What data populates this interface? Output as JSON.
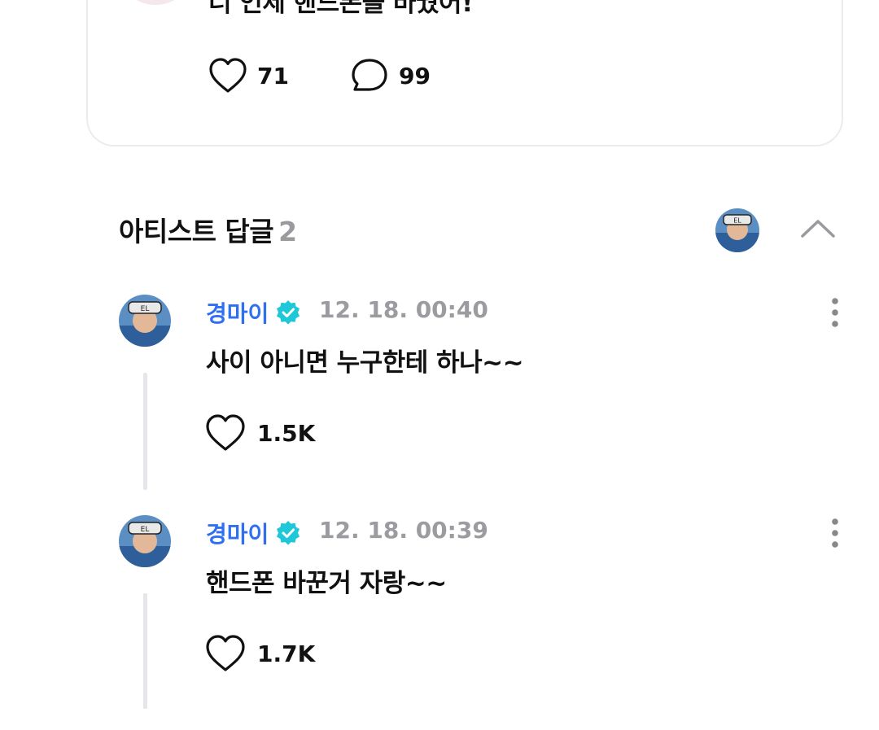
{
  "post": {
    "text": "너 언제 핸드폰을 바꿨어!",
    "likes": "71",
    "comments": "99",
    "avatar_icon": "food-bowl-avatar",
    "avatar_bg": "#f4e8ea"
  },
  "section": {
    "title": "아티스트 답글",
    "count": "2",
    "collapse_icon": "chevron-up-icon"
  },
  "replies": [
    {
      "author": "경마이",
      "timestamp": "12. 18. 00:40",
      "text": "사이 아니면 누구한테 하나~~",
      "likes": "1.5K"
    },
    {
      "author": "경마이",
      "timestamp": "12. 18. 00:39",
      "text": "핸드폰 바꾼거 자랑~~",
      "likes": "1.7K"
    }
  ],
  "colors": {
    "accent_blue": "#2f6ff0",
    "verified_teal": "#1fc8d8",
    "muted_gray": "#9c9ca0",
    "thread_line": "#e6e6ea"
  }
}
